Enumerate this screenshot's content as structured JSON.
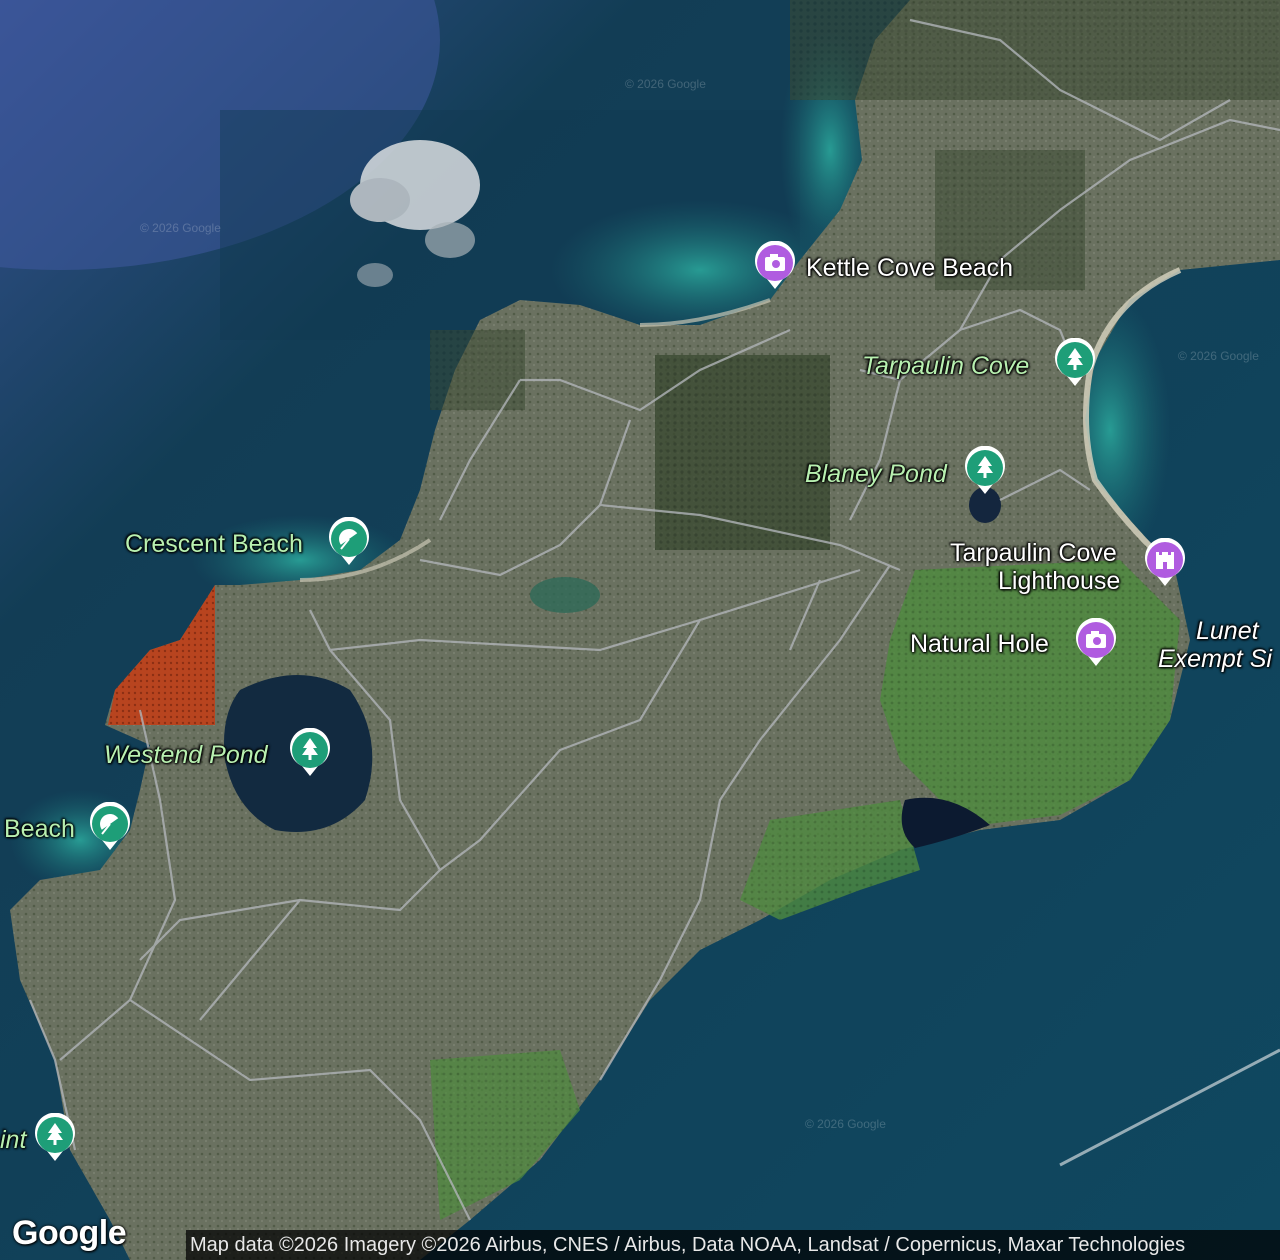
{
  "map": {
    "labels": {
      "kettle_cove_beach": "Kettle Cove Beach",
      "tarpaulin_cove": "Tarpaulin Cove",
      "blaney_pond": "Blaney Pond",
      "tarpaulin_cove_lighthouse_1": "Tarpaulin Cove",
      "tarpaulin_cove_lighthouse_2": "Lighthouse",
      "lunet_1": "Lunet",
      "lunet_2": "Exempt Si",
      "natural_hole": "Natural Hole",
      "crescent_beach": "Crescent Beach",
      "westend_pond": "Westend Pond",
      "beach": "Beach",
      "int": "int"
    },
    "watermark": "© 2026 Google",
    "logo": "Google",
    "attribution": "Map data ©2026 Imagery ©2026 Airbus, CNES / Airbus, Data NOAA, Landsat / Copernicus, Maxar Technologies",
    "colors": {
      "park_pin": "#1e9e78",
      "attraction_pin": "#b05ce0",
      "water": "#0f4a5e",
      "land": "#5f6a55"
    },
    "icons": {
      "park": "tree-icon",
      "attraction": "camera-icon",
      "beach": "umbrella-icon",
      "lighthouse": "castle-icon"
    }
  }
}
